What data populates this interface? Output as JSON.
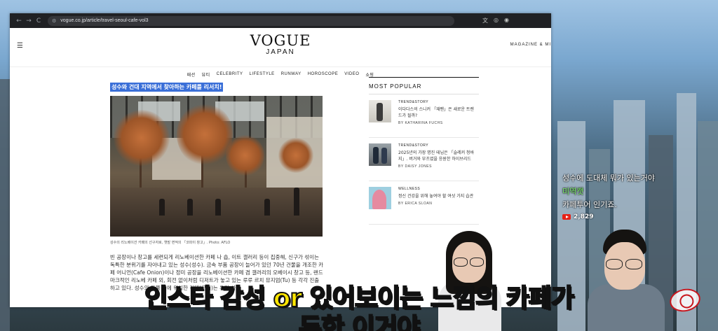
{
  "browser": {
    "url": "vogue.co.jp/article/travel-seoul-cafe-vol3",
    "nav": {
      "back": "←",
      "forward": "→",
      "reload": "C"
    }
  },
  "site": {
    "logo_main": "VOGUE",
    "logo_sub": "JAPAN",
    "magazine_link": "MAGAZINE & MI",
    "menu": [
      "패션",
      "뷰티",
      "CELEBRITY",
      "LIFESTYLE",
      "RUNWAY",
      "HOROSCOPE",
      "VIDEO",
      "쇼핑"
    ]
  },
  "article": {
    "highlighted_heading": "성수와 건대 지역에서 찾아하는 카페를 리서치!",
    "caption": "성수의 리노베이션 카페의 선구자로, 옛발 면적의 「코파이 창고」. Photo: AFLO",
    "body": "빈 공장이나 창고를 세련되게 리노베이션한 카페 나 숍, 이트 갤러리 등이 집중해, 신구가 섞이는 독특한 분위기를 자아내고 있는 성수(성수). 금속 부품 공장이 늘어가 있던 70년 건물을 개조한 카페 어니언(Cafe Onion)이나 정미 공장을 리노베이션한 카페 겸 갤러리의 오베이시 창고 등, 랜드마크적인 리노베 카페 외, 회전 없이처럼 디저트가 놓고 있는 루루 르치 뮤지엄(Tu) 등 각각 진출하고 있다. 성수의 동쪽 옆에 위치한 건대(곤대)는 유명 사립"
  },
  "sidebar": {
    "heading": "MOST POPULAR",
    "items": [
      {
        "category": "TREND&STORY",
        "title": "이다다스의 스니커 「재팬」은 새로운 트렌드가 될까?",
        "author": "BY KATHARINA FUCHS"
      },
      {
        "category": "TREND&STORY",
        "title": "2025년의 가장 명진 테님은 「슬레커 청바지」. 버거와 부츠였을 응원한 하이브리드",
        "author": "BY DAISY JONES"
      },
      {
        "category": "WELLNESS",
        "title": "정신 건강을 위해 놓여야 할 여섯 가지 습관",
        "author": "BY ERICA SLOAN"
      }
    ]
  },
  "overlay": {
    "line1": "성수에 도대체 뭐가 있는거야",
    "line2": "미역캣",
    "line3": "카페투어 인기죠.",
    "view_count": "2,829"
  },
  "subtitle": {
    "line1": "인스타 감성 or 있어보이는 느낌의 카페가",
    "line2": "두한 이거야"
  }
}
